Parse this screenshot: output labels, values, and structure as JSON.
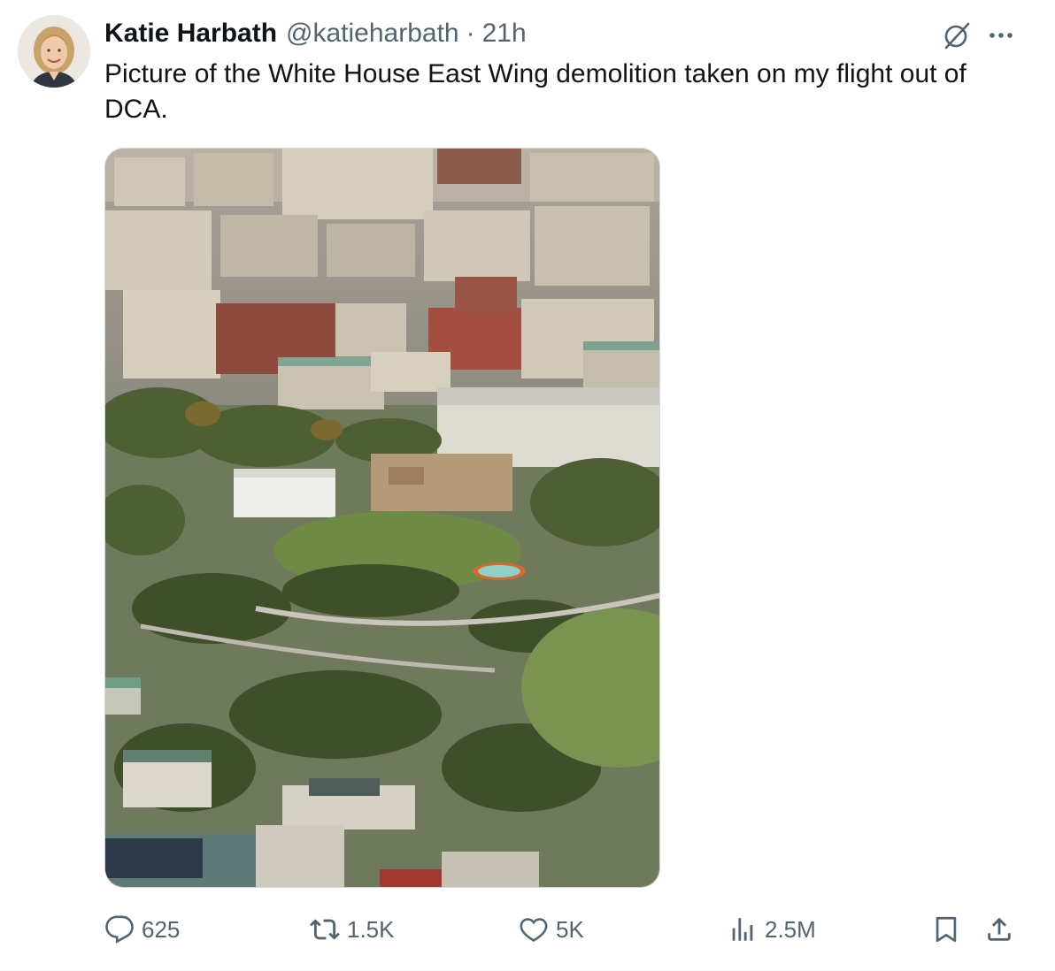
{
  "author": {
    "display_name": "Katie Harbath",
    "handle": "@katieharbath",
    "separator": "·",
    "time": "21h"
  },
  "tweet": {
    "text": "Picture of the White House East Wing demolition taken on my flight out of DCA."
  },
  "icons": {
    "avatar": "profile-photo",
    "grok": "grok-icon",
    "more": "more-horizontal-icon",
    "reply": "reply-icon",
    "retweet": "retweet-icon",
    "like": "heart-icon",
    "views": "views-icon",
    "bookmark": "bookmark-icon",
    "share": "share-icon"
  },
  "actions": {
    "replies": "625",
    "reposts": "1.5K",
    "likes": "5K",
    "views": "2.5M"
  },
  "colors": {
    "text_primary": "#0f1419",
    "text_secondary": "#536471",
    "border": "#cfd9de"
  }
}
